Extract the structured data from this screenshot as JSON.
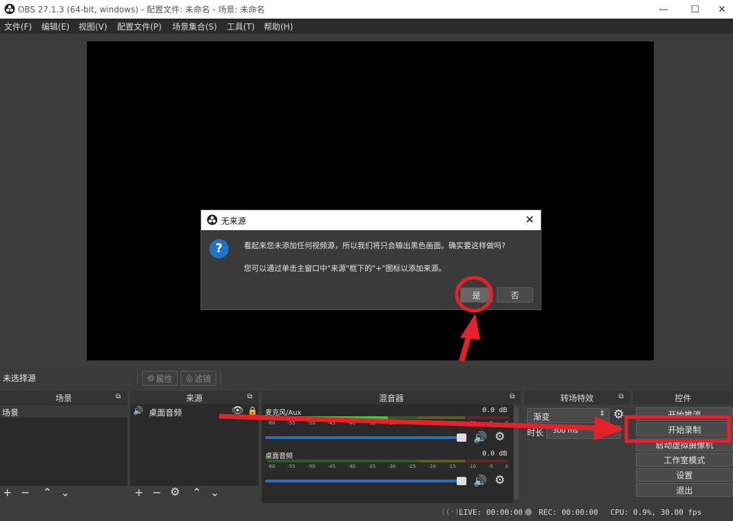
{
  "window": {
    "title": "OBS 27.1.3 (64-bit, windows) - 配置文件: 未命名 - 场景: 未命名"
  },
  "menu": [
    "文件(F)",
    "编辑(E)",
    "视图(V)",
    "配置文件(P)",
    "场景集合(S)",
    "工具(T)",
    "帮助(H)"
  ],
  "dialog": {
    "title": "无来源",
    "line1": "看起来您未添加任何视频源，所以我们将只会输出黑色画面。确实要这样做吗?",
    "line2": "您可以通过单击主窗口中\"来源\"框下的\"+\"图标以添加来源。",
    "yes": "是",
    "no": "否"
  },
  "source_bar": {
    "label": "未选择源",
    "properties": "属性",
    "filters": "滤镜"
  },
  "scenes": {
    "header": "场景",
    "items": [
      "场景"
    ]
  },
  "sources": {
    "header": "来源",
    "items": [
      "桌面音频"
    ]
  },
  "mixer": {
    "header": "混音器",
    "channels": [
      {
        "name": "麦克风/Aux",
        "db": "0.0 dB",
        "level": 0.5
      },
      {
        "name": "桌面音频",
        "db": "0.0 dB",
        "level": 0.0
      }
    ],
    "ticks": [
      "-60",
      "-55",
      "-50",
      "-45",
      "-40",
      "-35",
      "-30",
      "-25",
      "-20",
      "-15",
      "-10",
      "-5",
      "0"
    ]
  },
  "transitions": {
    "header": "转场特效",
    "selected": "渐变",
    "duration_label": "时长",
    "duration_value": "300 ms"
  },
  "controls": {
    "header": "控件",
    "buttons": [
      "开始推流",
      "开始录制",
      "启动虚拟摄像机",
      "工作室模式",
      "设置",
      "退出"
    ]
  },
  "status": {
    "live": "LIVE: 00:00:00",
    "rec": "REC: 00:00:00",
    "cpu": "CPU: 0.9%, 30.00 fps"
  },
  "colors": {
    "annotation": "#e8202a",
    "dialog_icon": "#1e73c8",
    "meter_green": "#3a7a33",
    "meter_yellow": "#7a7a2f",
    "meter_red": "#7a3333"
  }
}
